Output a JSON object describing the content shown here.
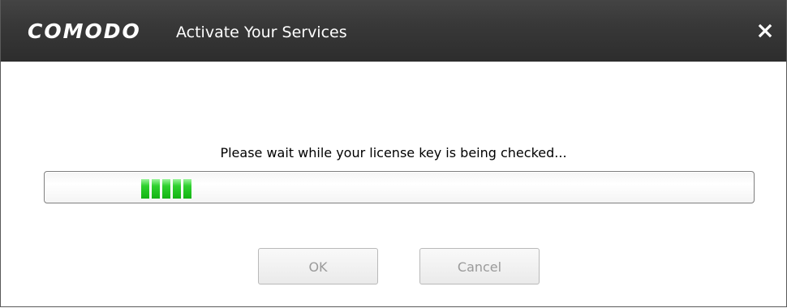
{
  "window": {
    "brand": "COMODO",
    "title": "Activate Your Services",
    "close_icon": "close-icon"
  },
  "main": {
    "message": "Please wait while your license key is being checked...",
    "progress": {
      "chunks": 5,
      "fraction_start": 0.136,
      "fraction_end": 0.225,
      "mode": "indeterminate-marquee",
      "color": "#22c722"
    }
  },
  "buttons": {
    "ok_label": "OK",
    "cancel_label": "Cancel",
    "enabled": false
  },
  "colors": {
    "titlebar": "#383838",
    "title_text": "#ffffff",
    "button_text_disabled": "#9a9a9a"
  }
}
